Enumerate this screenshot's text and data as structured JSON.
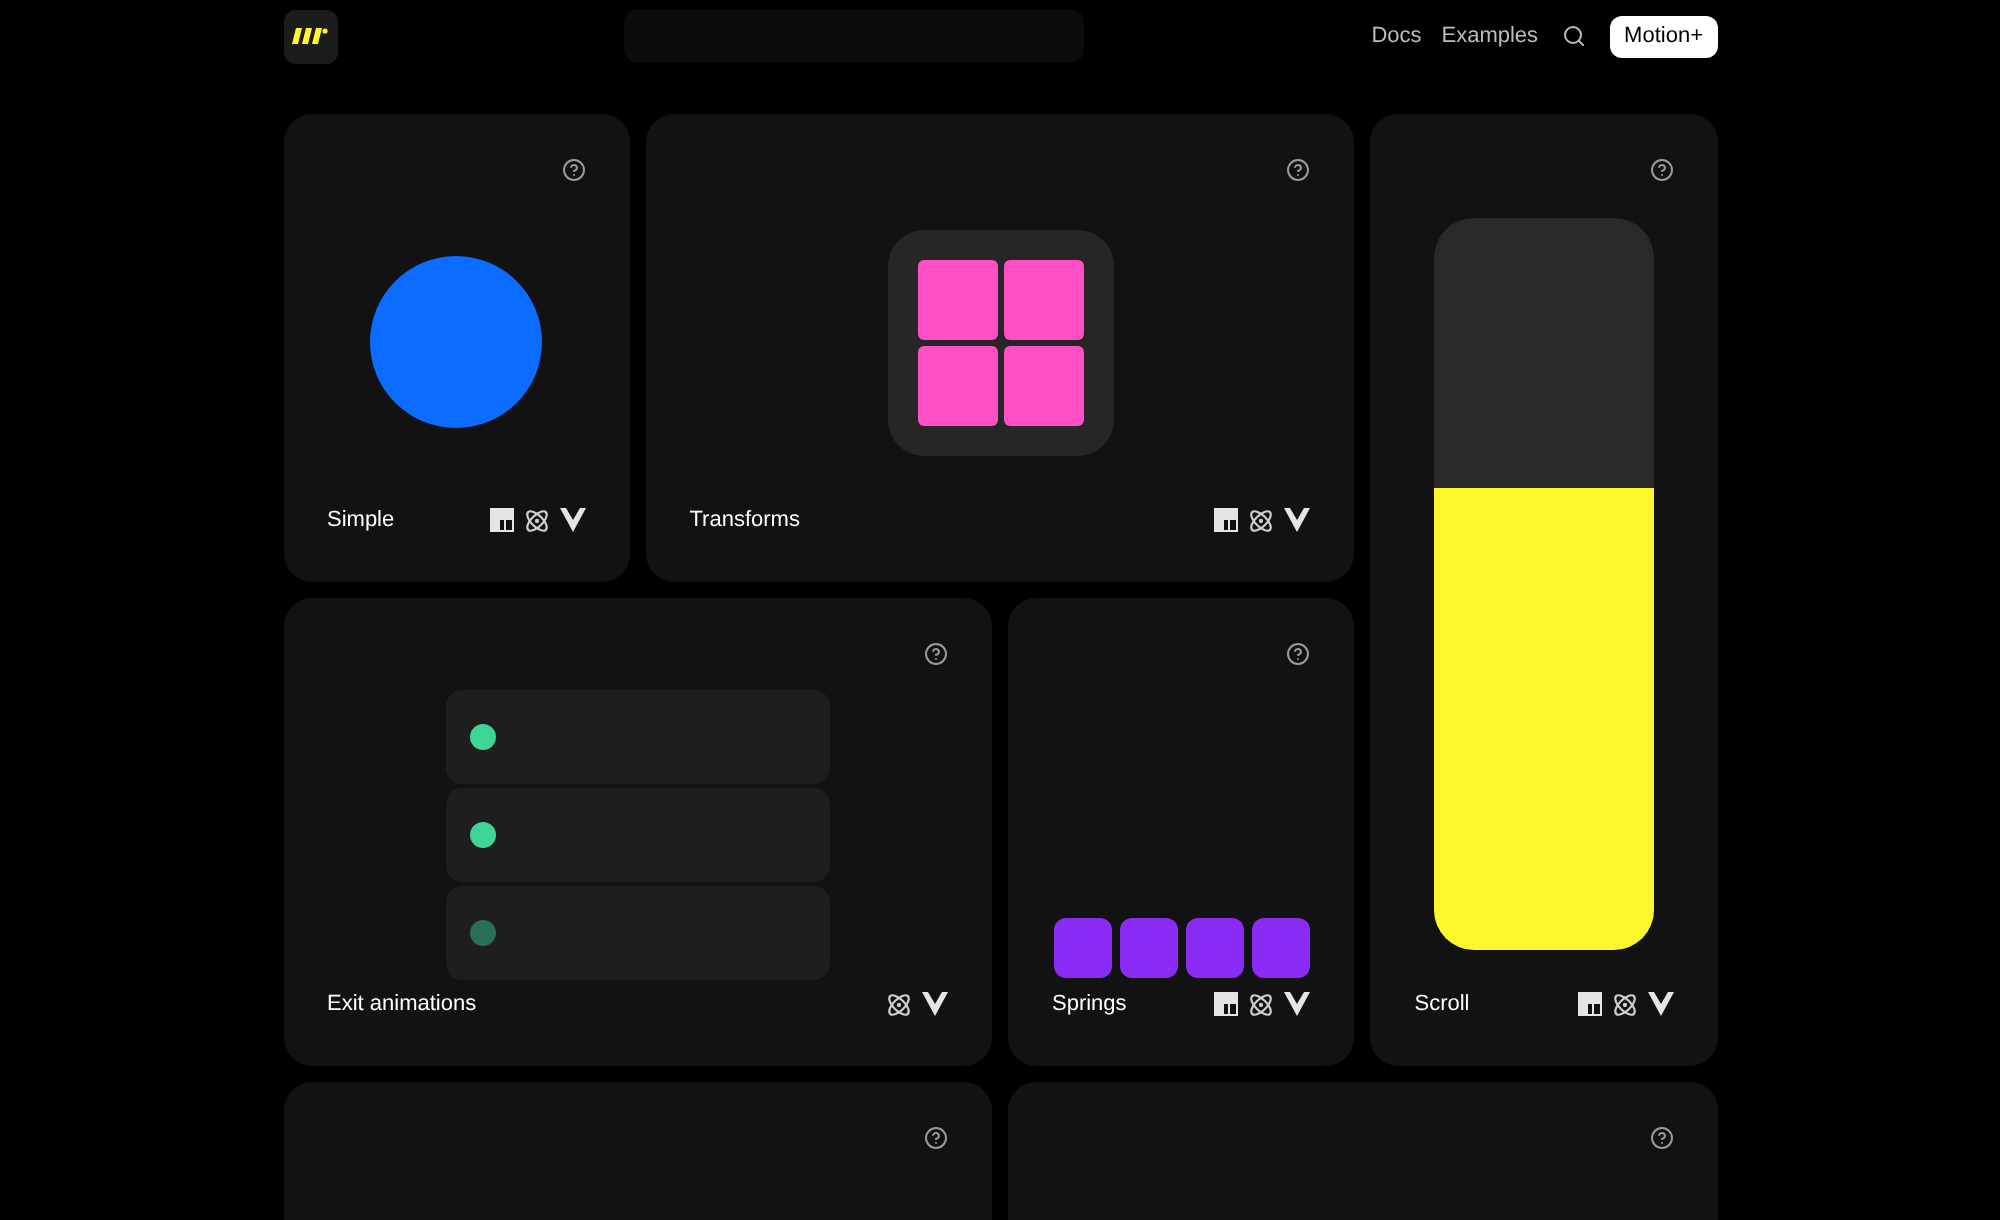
{
  "nav": {
    "links": [
      "Docs",
      "Examples"
    ],
    "button": "Motion+"
  },
  "cards": [
    {
      "kind": "simple",
      "title": "Simple",
      "frameworks": [
        {
          "kind": "js"
        },
        {
          "kind": "react"
        },
        {
          "kind": "vue"
        }
      ]
    },
    {
      "kind": "transforms",
      "title": "Transforms",
      "frameworks": [
        {
          "kind": "js"
        },
        {
          "kind": "react"
        },
        {
          "kind": "vue"
        }
      ]
    },
    {
      "kind": "exit",
      "title": "Exit animations",
      "items": [
        {
          "color": "#3ed598"
        },
        {
          "color": "#3ed598"
        },
        {
          "color": "#2a6e55"
        }
      ],
      "frameworks": [
        {
          "kind": "react"
        },
        {
          "kind": "vue"
        }
      ]
    },
    {
      "kind": "springs",
      "title": "Springs",
      "frameworks": [
        {
          "kind": "js"
        },
        {
          "kind": "react"
        },
        {
          "kind": "vue"
        }
      ]
    },
    {
      "kind": "scroll",
      "title": "Scroll",
      "level": 0.63,
      "frameworks": [
        {
          "kind": "js"
        },
        {
          "kind": "react"
        },
        {
          "kind": "vue"
        }
      ]
    },
    {
      "kind": "partial-left"
    },
    {
      "kind": "partial-right"
    }
  ]
}
